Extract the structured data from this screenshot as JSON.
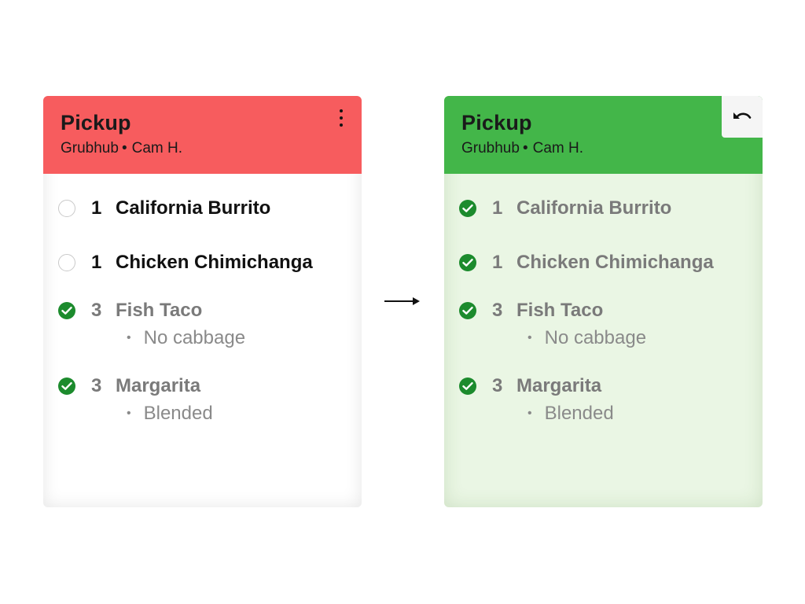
{
  "colors": {
    "urgent_header": "#f75c5e",
    "done_header": "#43b649",
    "check_green": "#1c8b2d"
  },
  "before": {
    "title": "Pickup",
    "source": "Grubhub",
    "separator": "•",
    "customer": "Cam H.",
    "menu_icon": "more-vertical-icon",
    "items": [
      {
        "status": "unchecked",
        "qty": "1",
        "name": "California Burrito",
        "modifier": ""
      },
      {
        "status": "unchecked",
        "qty": "1",
        "name": "Chicken Chimichanga",
        "modifier": ""
      },
      {
        "status": "checked",
        "qty": "3",
        "name": "Fish Taco",
        "modifier": "No cabbage"
      },
      {
        "status": "checked",
        "qty": "3",
        "name": "Margarita",
        "modifier": "Blended"
      }
    ]
  },
  "transition": {
    "icon": "arrow-right-icon"
  },
  "after": {
    "title": "Pickup",
    "source": "Grubhub",
    "separator": "•",
    "customer": "Cam H.",
    "undo_icon": "undo-icon",
    "items": [
      {
        "status": "checked",
        "qty": "1",
        "name": "California Burrito",
        "modifier": ""
      },
      {
        "status": "checked",
        "qty": "1",
        "name": "Chicken Chimichanga",
        "modifier": ""
      },
      {
        "status": "checked",
        "qty": "3",
        "name": "Fish Taco",
        "modifier": "No cabbage"
      },
      {
        "status": "checked",
        "qty": "3",
        "name": "Margarita",
        "modifier": "Blended"
      }
    ]
  }
}
